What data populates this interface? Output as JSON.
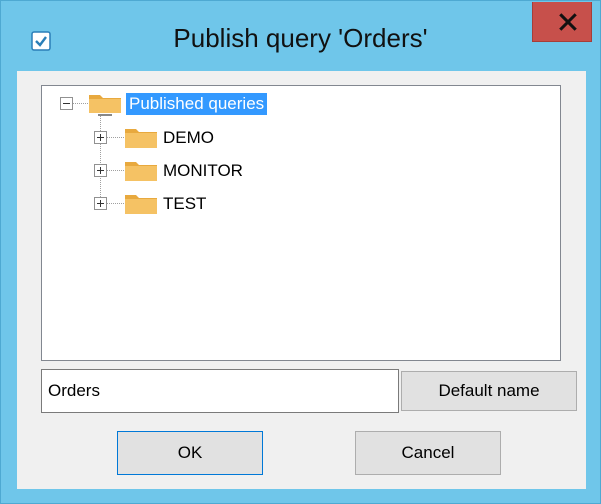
{
  "window": {
    "title": "Publish query 'Orders'",
    "close_glyph": "x",
    "app_icon": "check-square-icon"
  },
  "tree": {
    "root": {
      "label": "Published queries",
      "expanded": true,
      "selected": true,
      "icon": "folder-icon",
      "expander_glyph": "−"
    },
    "children": [
      {
        "label": "DEMO",
        "expanded": false,
        "icon": "folder-icon",
        "expander_glyph": "+"
      },
      {
        "label": "MONITOR",
        "expanded": false,
        "icon": "folder-icon",
        "expander_glyph": "+"
      },
      {
        "label": "TEST",
        "expanded": false,
        "icon": "folder-icon",
        "expander_glyph": "+"
      }
    ]
  },
  "name_field": {
    "value": "Orders"
  },
  "buttons": {
    "default_name": "Default name",
    "ok": "OK",
    "cancel": "Cancel"
  },
  "colors": {
    "frame": "#6fc6ea",
    "close": "#c7504b",
    "selection": "#3399ff",
    "folder": "#f5c264"
  }
}
